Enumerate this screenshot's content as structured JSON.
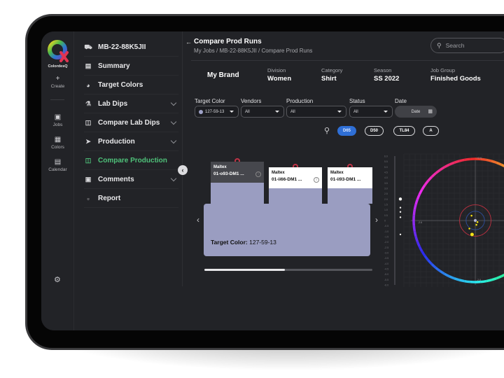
{
  "app": {
    "name": "ColordesQ",
    "rail": [
      {
        "icon": "plus-icon",
        "label": "Create"
      },
      {
        "icon": "briefcase-icon",
        "label": "Jobs"
      },
      {
        "icon": "colors-icon",
        "label": "Colors"
      },
      {
        "icon": "calendar-icon",
        "label": "Calendar"
      }
    ]
  },
  "nav": {
    "job_id": "MB-22-88K5JII",
    "items": [
      {
        "label": "Summary",
        "icon": "clipboard-icon",
        "expandable": false,
        "active": false
      },
      {
        "label": "Target Colors",
        "icon": "palette-icon",
        "expandable": false,
        "active": false
      },
      {
        "label": "Lab Dips",
        "icon": "flask-icon",
        "expandable": true,
        "active": false
      },
      {
        "label": "Compare Lab Dips",
        "icon": "compare-icon",
        "expandable": true,
        "active": false
      },
      {
        "label": "Production",
        "icon": "rocket-icon",
        "expandable": true,
        "active": false
      },
      {
        "label": "Compare Production",
        "icon": "compare-icon",
        "expandable": false,
        "active": true
      },
      {
        "label": "Comments",
        "icon": "comment-icon",
        "expandable": true,
        "active": false
      },
      {
        "label": "Report",
        "icon": "report-icon",
        "expandable": false,
        "active": false
      }
    ]
  },
  "header": {
    "title": "Compare Prod Runs",
    "breadcrumb": "My Jobs / MB-22-88K5JII / Compare Prod Runs",
    "search_placeholder": "Search"
  },
  "meta": {
    "brand": "My Brand",
    "fields": [
      {
        "label": "Division",
        "value": "Women"
      },
      {
        "label": "Category",
        "value": "Shirt"
      },
      {
        "label": "Season",
        "value": "SS 2022"
      },
      {
        "label": "Job Group",
        "value": "Finished Goods"
      }
    ]
  },
  "filters": {
    "target_color": {
      "label": "Target Color",
      "value": "127-59-13"
    },
    "vendors": {
      "label": "Vendors",
      "value": "All"
    },
    "production": {
      "label": "Production",
      "value": "All"
    },
    "status": {
      "label": "Status",
      "value": "All"
    },
    "date": {
      "label": "Date",
      "value": "Date"
    }
  },
  "illuminants": [
    {
      "label": "D65",
      "active": true
    },
    {
      "label": "D50",
      "active": false
    },
    {
      "label": "TL84",
      "active": false
    },
    {
      "label": "A",
      "active": false
    }
  ],
  "swatches": {
    "target_label": "Target Color:",
    "target_value": "127-59-13",
    "swatch_color": "#9a9dc1",
    "cards": [
      {
        "vendor": "Maltex",
        "code": "01-o93-DM1 ...",
        "selected": true,
        "info": true
      },
      {
        "vendor": "Maltex",
        "code": "01-ii66-DM1 ...",
        "selected": false,
        "info": true
      },
      {
        "vendor": "Maltex",
        "code": "01-ii93-DM1 ...",
        "selected": false,
        "info": false
      }
    ],
    "scroll_progress": 0.48
  },
  "chart_data": {
    "type": "scatter",
    "title": "",
    "lightness_axis": {
      "ticks": [
        "6.0",
        "5.5",
        "5.0",
        "4.5",
        "4.0",
        "3.5",
        "3.0",
        "2.5",
        "2.0",
        "1.5",
        "1.0",
        "0.5",
        "0",
        "-0.5",
        "-1.0",
        "-1.5",
        "-2.0",
        "-2.5",
        "-3.0",
        "-3.5",
        "-4.0",
        "-4.5",
        "-5.0",
        "-5.5",
        "-6.0"
      ],
      "range": [
        -6.0,
        6.0
      ],
      "points": [
        2.0,
        1.2,
        0.8,
        0.3,
        -1.3
      ]
    },
    "ab_plane": {
      "x_label_neg": "-2.6",
      "y_label_pos": "+2.6",
      "y_label_neg": "-2.6",
      "range": [
        -2.6,
        2.6
      ],
      "tolerance_rings": [
        0.5,
        0.3
      ],
      "center": [
        0,
        0
      ],
      "points": [
        {
          "a": -0.35,
          "b": 0.45,
          "size": "small"
        },
        {
          "a": 0.2,
          "b": -0.15,
          "size": "small"
        },
        {
          "a": 0.1,
          "b": -0.4,
          "size": "small"
        },
        {
          "a": -0.55,
          "b": -0.75,
          "size": "small"
        },
        {
          "a": -0.3,
          "b": -1.3,
          "size": "large"
        }
      ]
    },
    "grid": true
  }
}
